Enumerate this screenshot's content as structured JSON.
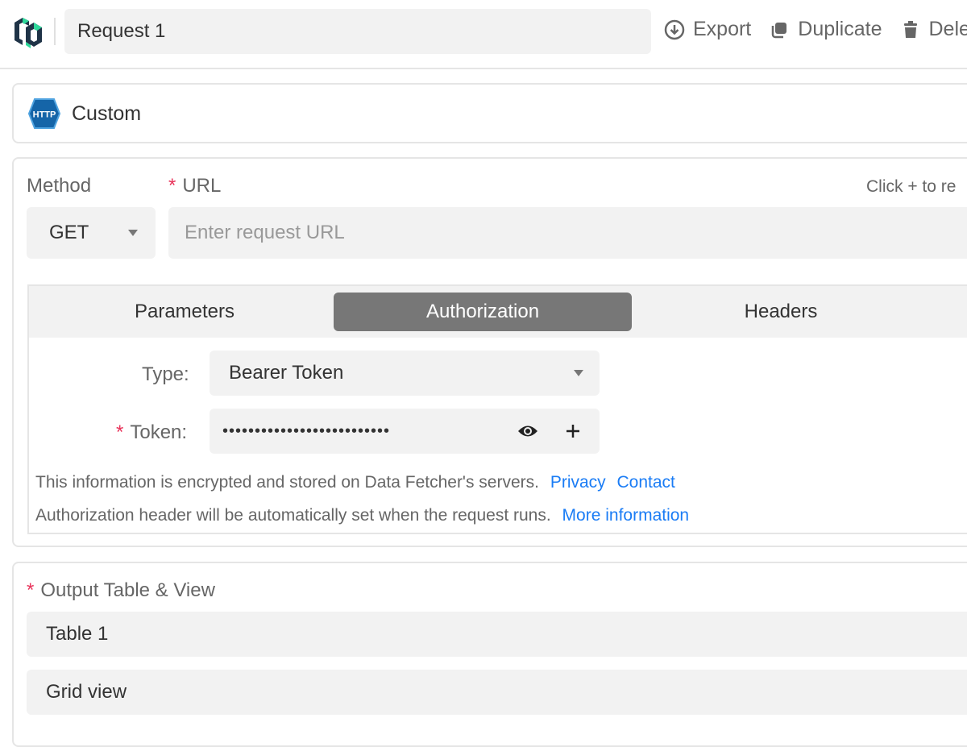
{
  "header": {
    "title": "Request 1",
    "actions": [
      {
        "label": "Export",
        "icon": "download-circle-icon"
      },
      {
        "label": "Duplicate",
        "icon": "duplicate-icon"
      },
      {
        "label": "Delete",
        "icon": "trash-icon"
      }
    ]
  },
  "source": {
    "label": "Custom",
    "icon": "http-icon",
    "icon_text": "HTTP"
  },
  "request": {
    "method_label": "Method",
    "method_value": "GET",
    "url_label": "URL",
    "url_placeholder": "Enter request URL",
    "url_hint": "Click + to re",
    "tabs": [
      {
        "label": "Parameters",
        "active": false
      },
      {
        "label": "Authorization",
        "active": true
      },
      {
        "label": "Headers",
        "active": false
      }
    ],
    "auth": {
      "type_label": "Type:",
      "type_value": "Bearer Token",
      "token_label": "Token:",
      "token_value": "••••••••••••••••••••••••••",
      "encrypted_note": "This information is encrypted and stored on Data Fetcher's servers.",
      "privacy_link": "Privacy",
      "contact_link": "Contact",
      "header_note": "Authorization header will be automatically set when the request runs.",
      "more_link": "More information"
    }
  },
  "output": {
    "label": "Output Table & View",
    "table": "Table 1",
    "view": "Grid view"
  },
  "colors": {
    "required": "#e8335a",
    "link": "#1a7cf5",
    "active_tab": "#777777",
    "logo_green": "#2ed89a",
    "logo_dark": "#1f3347",
    "http_blue": "#1565a8"
  }
}
